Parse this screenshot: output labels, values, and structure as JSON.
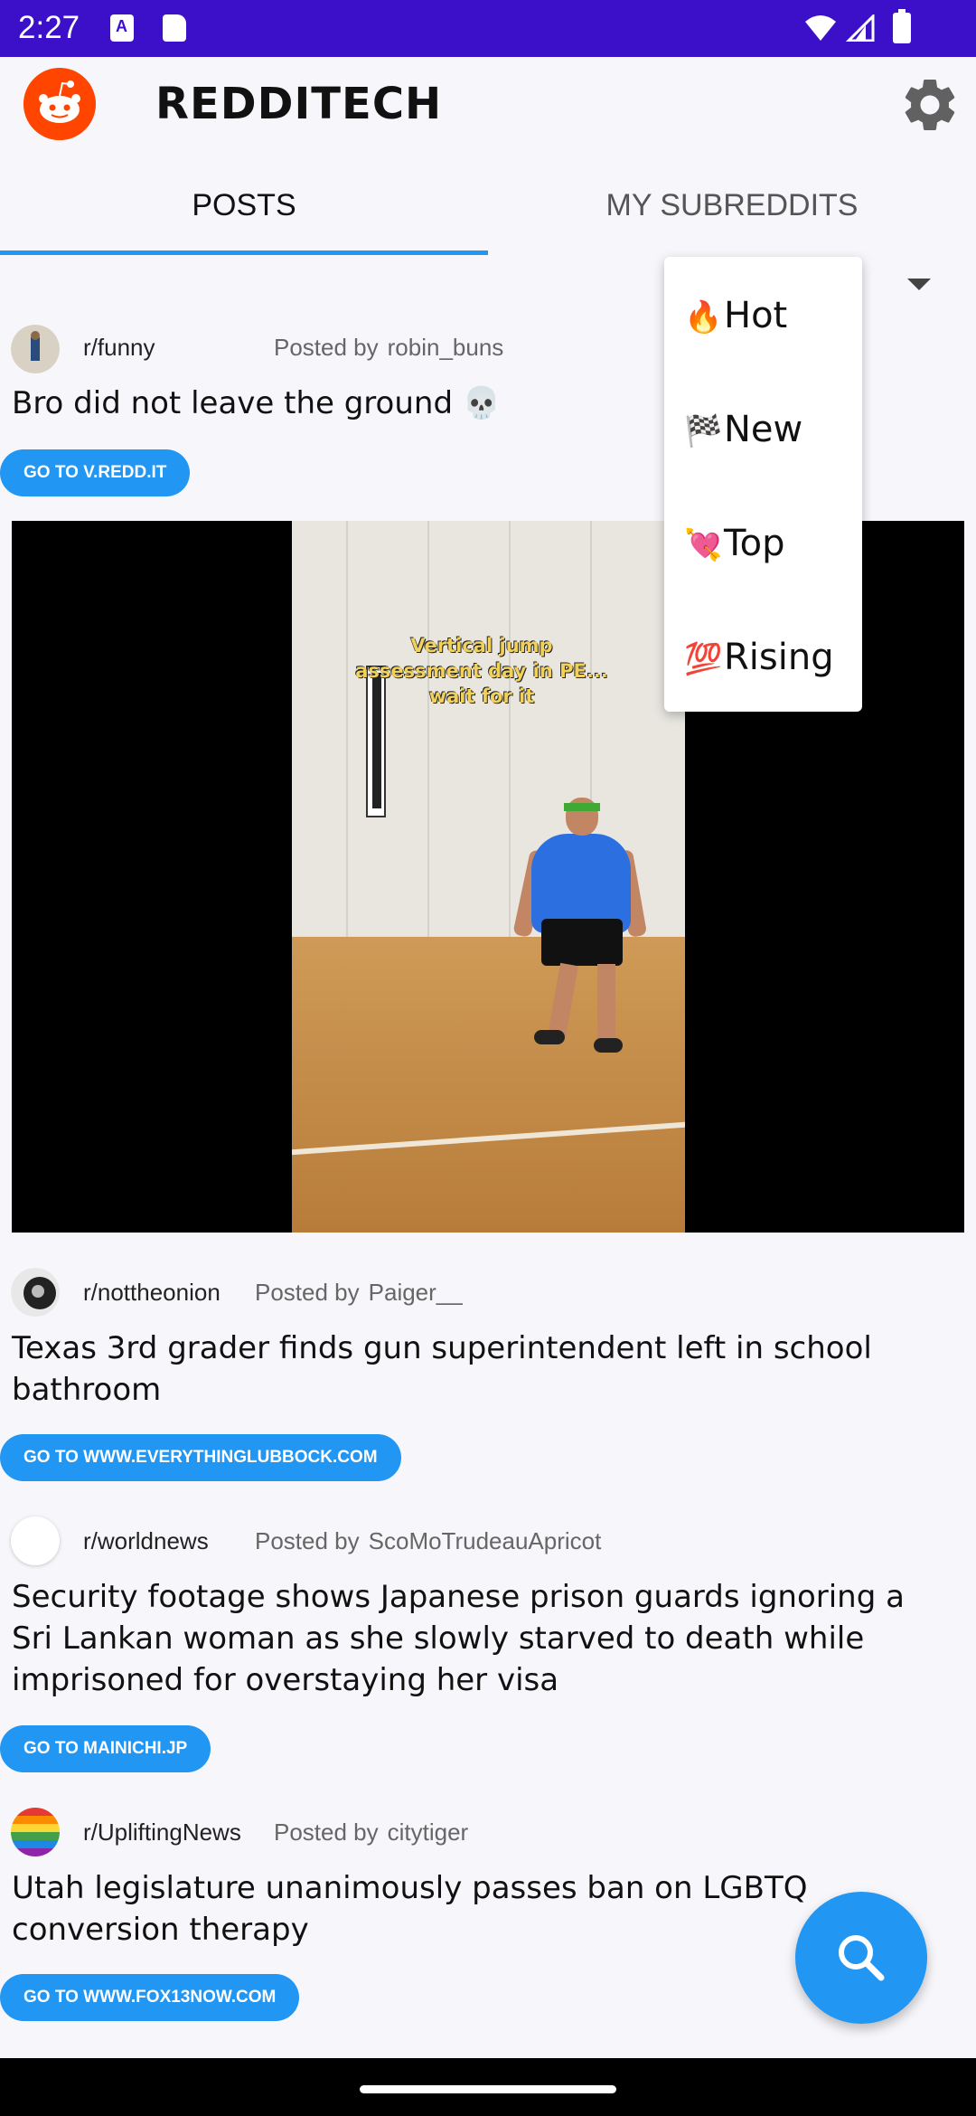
{
  "status_bar": {
    "time": "2:27"
  },
  "app": {
    "title": "REDDITECH"
  },
  "tabs": [
    {
      "label": "POSTS",
      "selected": true
    },
    {
      "label": "MY SUBREDDITS",
      "selected": false
    }
  ],
  "sort_menu": {
    "items": [
      {
        "icon": "🔥",
        "label": "Hot"
      },
      {
        "icon": "🏁",
        "label": "New"
      },
      {
        "icon": "💘",
        "label": "Top"
      },
      {
        "icon": "💯",
        "label": "Rising"
      }
    ]
  },
  "posts": [
    {
      "subreddit": "r/funny",
      "posted_by_label": "Posted by",
      "author": "robin_buns",
      "title": "Bro did not leave the ground 💀",
      "link_label": "GO TO V.REDD.IT",
      "media_caption": "Vertical jump assessment day in PE... wait for it"
    },
    {
      "subreddit": "r/nottheonion",
      "posted_by_label": "Posted by",
      "author": "Paiger__",
      "title": "Texas 3rd grader finds gun superintendent left in school bathroom",
      "link_label": "GO TO WWW.EVERYTHINGLUBBOCK.COM"
    },
    {
      "subreddit": "r/worldnews",
      "posted_by_label": "Posted by",
      "author": "ScoMoTrudeauApricot",
      "title": "Security footage shows Japanese prison guards ignoring a Sri Lankan woman as she slowly starved to death while imprisoned for overstaying her visa",
      "link_label": "GO TO MAINICHI.JP"
    },
    {
      "subreddit": "r/UpliftingNews",
      "posted_by_label": "Posted by",
      "author": "citytiger",
      "title": "Utah legislature unanimously passes ban on LGBTQ conversion therapy",
      "link_label": "GO TO WWW.FOX13NOW.COM"
    }
  ],
  "colors": {
    "status_bar": "#3c10c8",
    "accent": "#2196f3",
    "reddit_orange": "#ff4500"
  }
}
